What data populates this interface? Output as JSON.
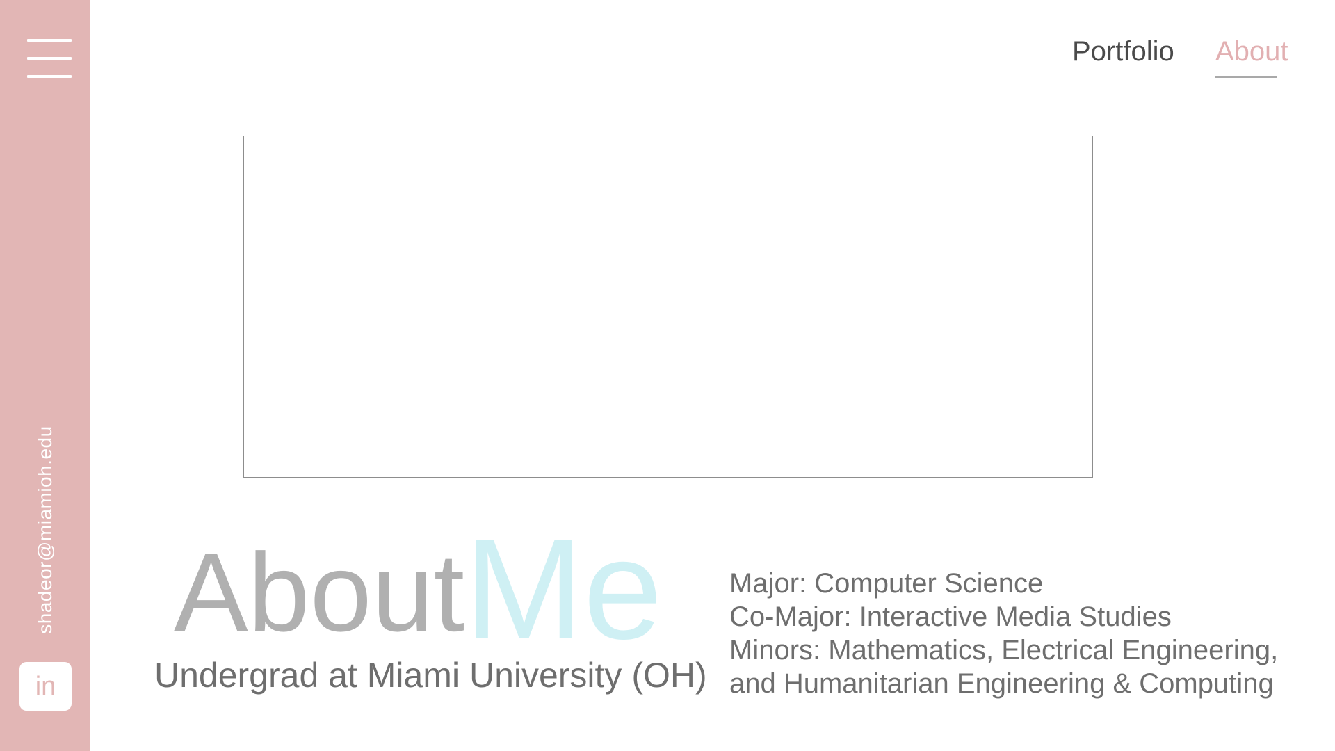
{
  "sidebar": {
    "email": "shadeor@miamioh.edu",
    "linkedin_label": "in",
    "menu_icon": "hamburger-menu-icon"
  },
  "nav": {
    "portfolio": "Portfolio",
    "about": "About",
    "active": "About",
    "active_color": "#e2b0b2"
  },
  "colors": {
    "sidebar": "#e2b6b5",
    "heading_about": "#b0b0b0",
    "heading_me": "#cff0f4",
    "body_text": "#6e6e6e"
  },
  "hero": {
    "heading_part1": "About",
    "heading_part2": "Me",
    "subtitle": "Undergrad at Miami University (OH)"
  },
  "details": {
    "major": "Major: Computer Science",
    "co_major": "Co-Major: Interactive Media Studies",
    "minors_line1": "Minors: Mathematics, Electrical Engineering,",
    "minors_line2": "and Humanitarian Engineering & Computing"
  }
}
